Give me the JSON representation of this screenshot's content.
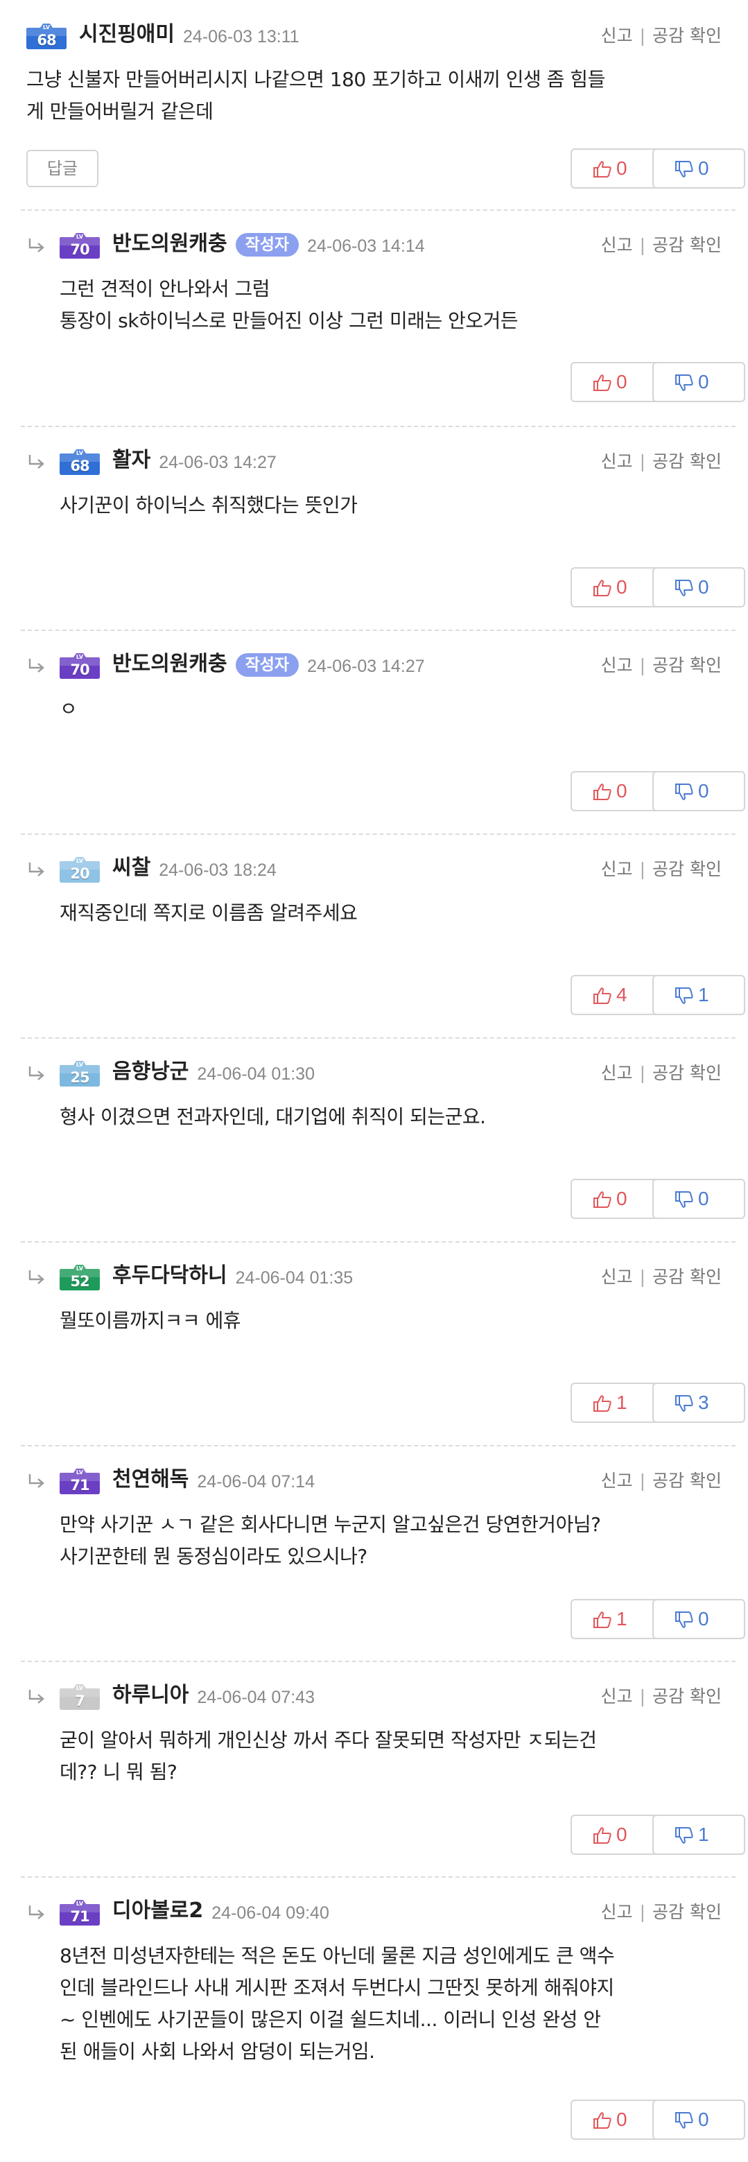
{
  "labels": {
    "report": "신고",
    "empathy": "공감 확인",
    "reply": "답글",
    "author": "작성자"
  },
  "colors": {
    "like": "#e0565b",
    "dislike": "#4a7bd1",
    "author_badge": "#8ca0f0"
  },
  "comments": [
    {
      "username": "시진핑애미",
      "level": "68",
      "level_color": "#2f6fd6",
      "timestamp": "24-06-03 13:11",
      "is_reply": false,
      "is_author": false,
      "text_lines": [
        "그냥 신불자 만들어버리시지 나같으면 180 포기하고 이새끼 인생 좀 힘들",
        "게 만들어버릴거 같은데"
      ],
      "likes": "0",
      "dislikes": "0"
    },
    {
      "username": "반도의원캐충",
      "level": "70",
      "level_color": "#6b3fc4",
      "timestamp": "24-06-03 14:14",
      "is_reply": true,
      "is_author": true,
      "text_lines": [
        "그런 견적이 안나와서 그럼",
        "통장이 sk하이닉스로 만들어진 이상 그런 미래는 안오거든"
      ],
      "likes": "0",
      "dislikes": "0"
    },
    {
      "username": "활자",
      "level": "68",
      "level_color": "#2f6fd6",
      "timestamp": "24-06-03 14:27",
      "is_reply": true,
      "is_author": false,
      "text_lines": [
        "사기꾼이 하이닉스 취직했다는 뜻인가"
      ],
      "likes": "0",
      "dislikes": "0"
    },
    {
      "username": "반도의원캐충",
      "level": "70",
      "level_color": "#6b3fc4",
      "timestamp": "24-06-03 14:27",
      "is_reply": true,
      "is_author": true,
      "text_lines": [
        "ㅇ"
      ],
      "likes": "0",
      "dislikes": "0"
    },
    {
      "username": "씨찰",
      "level": "20",
      "level_color": "#8fc3e6",
      "timestamp": "24-06-03 18:24",
      "is_reply": true,
      "is_author": false,
      "text_lines": [
        "재직중인데 쪽지로 이름좀 알려주세요"
      ],
      "likes": "4",
      "dislikes": "1"
    },
    {
      "username": "음향낭군",
      "level": "25",
      "level_color": "#7db8e0",
      "timestamp": "24-06-04 01:30",
      "is_reply": true,
      "is_author": false,
      "text_lines": [
        "형사 이겼으면 전과자인데, 대기업에 취직이 되는군요."
      ],
      "likes": "0",
      "dislikes": "0"
    },
    {
      "username": "후두다닥하니",
      "level": "52",
      "level_color": "#1e9a5a",
      "timestamp": "24-06-04 01:35",
      "is_reply": true,
      "is_author": false,
      "text_lines": [
        "뭘또이름까지ㅋㅋ 에휴"
      ],
      "likes": "1",
      "dislikes": "3"
    },
    {
      "username": "천연해독",
      "level": "71",
      "level_color": "#6b3fc4",
      "timestamp": "24-06-04 07:14",
      "is_reply": true,
      "is_author": false,
      "text_lines": [
        "만약 사기꾼 ㅅㄱ 같은 회사다니면 누군지 알고싶은건 당연한거아님?",
        "사기꾼한테 뭔 동정심이라도 있으시나?"
      ],
      "likes": "1",
      "dislikes": "0"
    },
    {
      "username": "하루니아",
      "level": "7",
      "level_color": "#c9c9c9",
      "timestamp": "24-06-04 07:43",
      "is_reply": true,
      "is_author": false,
      "text_lines": [
        "굳이 알아서 뭐하게 개인신상 까서 주다 잘못되면 작성자만 ㅈ되는건",
        "데?? 니 뭐 됨?"
      ],
      "likes": "0",
      "dislikes": "1"
    },
    {
      "username": "디아볼로2",
      "level": "71",
      "level_color": "#6b3fc4",
      "timestamp": "24-06-04 09:40",
      "is_reply": true,
      "is_author": false,
      "text_lines": [
        "8년전 미성년자한테는 적은 돈도 아닌데 물론 지금 성인에게도 큰 액수",
        "인데 블라인드나 사내 게시판 조져서 두번다시 그딴짓 못하게 해줘야지",
        "~ 인벤에도 사기꾼들이 많은지 이걸 쉴드치네... 이러니 인성 완성 안",
        "된 애들이 사회 나와서 암덩이 되는거임."
      ],
      "likes": "0",
      "dislikes": "0"
    }
  ]
}
